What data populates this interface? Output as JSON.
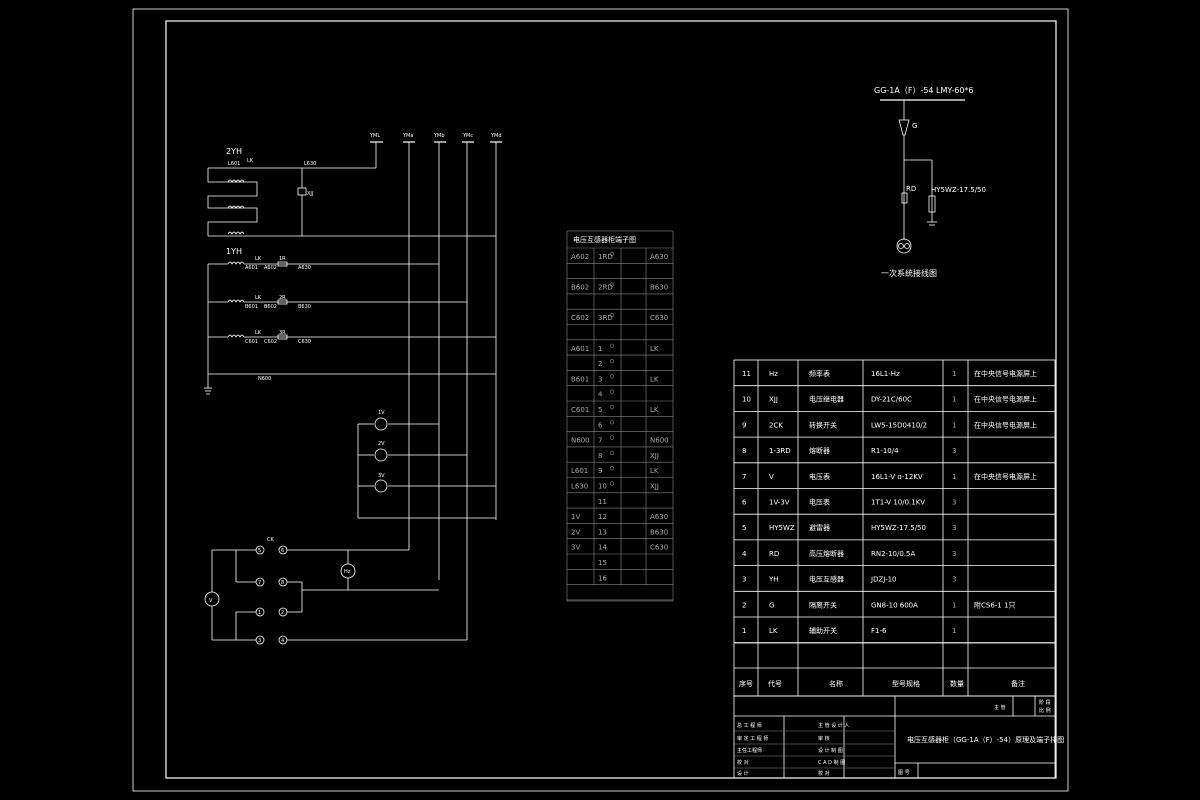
{
  "primary": {
    "header": "GG-1A（F）-54  LMY-60*6",
    "g_label": "G",
    "rd_label": "RD",
    "arrester_label": "HY5WZ-17.5/50",
    "caption": "一次系统接线图"
  },
  "schematic": {
    "bus_labels": [
      "YML",
      "YMa",
      "YMb",
      "YMc",
      "YMd"
    ],
    "vt2_label": "2YH",
    "vt1_label": "1YH",
    "xjj_label": "XJJ",
    "lk_label": "LK",
    "ck_label": "CK",
    "wire_labels": {
      "l601": "L601",
      "l630": "L630",
      "a601": "A601",
      "a602": "A602",
      "a630": "A630",
      "b601": "B601",
      "b602": "B602",
      "b630": "B630",
      "c601": "C601",
      "c602": "C602",
      "c630": "C630",
      "n600": "N600",
      "rd1": "1R",
      "rd2": "2R",
      "rd3": "3R"
    },
    "meters": [
      "1V",
      "2V",
      "3V"
    ],
    "freq_meter": "Hz",
    "voltmeter": "V",
    "switch_contacts": [
      "5",
      "6",
      "7",
      "8",
      "1",
      "2",
      "3",
      "4"
    ]
  },
  "terminal": {
    "title": "电压互感器柜端子图",
    "rows": [
      {
        "left": "A602",
        "mid": "1RD",
        "right": "A630"
      },
      {
        "left": "",
        "mid": "",
        "right": ""
      },
      {
        "left": "B602",
        "mid": "2RD",
        "right": "B630"
      },
      {
        "left": "",
        "mid": "",
        "right": ""
      },
      {
        "left": "C602",
        "mid": "3RD",
        "right": "C630"
      },
      {
        "left": "",
        "mid": "",
        "right": ""
      },
      {
        "left": "A601",
        "mid": "1",
        "right": "LK"
      },
      {
        "left": "",
        "mid": "2",
        "right": ""
      },
      {
        "left": "B601",
        "mid": "3",
        "right": "LK"
      },
      {
        "left": "",
        "mid": "4",
        "right": ""
      },
      {
        "left": "C601",
        "mid": "5",
        "right": "LK"
      },
      {
        "left": "",
        "mid": "6",
        "right": ""
      },
      {
        "left": "N600",
        "mid": "7",
        "right": "N600"
      },
      {
        "left": "",
        "mid": "8",
        "right": "XJJ"
      },
      {
        "left": "L601",
        "mid": "9",
        "right": "LK"
      },
      {
        "left": "L630",
        "mid": "10",
        "right": "XJJ"
      },
      {
        "left": "",
        "mid": "11",
        "right": ""
      },
      {
        "left": "1V",
        "mid": "12",
        "right": "A630"
      },
      {
        "left": "2V",
        "mid": "13",
        "right": "B630"
      },
      {
        "left": "3V",
        "mid": "14",
        "right": "C630"
      },
      {
        "left": "",
        "mid": "15",
        "right": ""
      },
      {
        "left": "",
        "mid": "16",
        "right": ""
      },
      {
        "left": "",
        "mid": "",
        "right": ""
      }
    ]
  },
  "bom": {
    "headers": {
      "no": "序号",
      "code": "代号",
      "name": "名称",
      "model": "型号规格",
      "qty": "数量",
      "note": "备注"
    },
    "rows": [
      {
        "no": "11",
        "code": "Hz",
        "name": "频率表",
        "model": "16L1-Hz",
        "qty": "1",
        "note": "在中央信号电源屏上"
      },
      {
        "no": "10",
        "code": "XJJ",
        "name": "电压继电器",
        "model": "DY-21C/60C",
        "qty": "1",
        "note": "在中央信号电源屏上"
      },
      {
        "no": "9",
        "code": "2CK",
        "name": "转换开关",
        "model": "LW5-15D0410/2",
        "qty": "1",
        "note": "在中央信号电源屏上"
      },
      {
        "no": "8",
        "code": "1-3RD",
        "name": "熔断器",
        "model": "R1-10/4",
        "qty": "3",
        "note": ""
      },
      {
        "no": "7",
        "code": "V",
        "name": "电压表",
        "model": "16L1-V ɑ-12KV",
        "qty": "1",
        "note": "在中央信号电源屏上"
      },
      {
        "no": "6",
        "code": "1V-3V",
        "name": "电压表",
        "model": "1T1-V 10/0.1KV",
        "qty": "3",
        "note": ""
      },
      {
        "no": "5",
        "code": "HY5WZ",
        "name": "避雷器",
        "model": "HY5WZ-17.5/50",
        "qty": "3",
        "note": ""
      },
      {
        "no": "4",
        "code": "RD",
        "name": "高压熔断器",
        "model": "RN2-10/0.5A",
        "qty": "3",
        "note": ""
      },
      {
        "no": "3",
        "code": "YH",
        "name": "电压互感器",
        "model": "JDZJ-10",
        "qty": "3",
        "note": ""
      },
      {
        "no": "2",
        "code": "G",
        "name": "隔离开关",
        "model": "GN8-10 600A",
        "qty": "1",
        "note": "附CS6-1 1只"
      },
      {
        "no": "1",
        "code": "LK",
        "name": "辅助开关",
        "model": "F1-6",
        "qty": "1",
        "note": ""
      }
    ]
  },
  "title_block": {
    "drawing_title": "电压互感器柜（GG-1A（F）-54）原理及端子排图",
    "left_labels": [
      "总 工 程 师",
      "审 定 工 程 师",
      "主任工程师",
      "校 对",
      "设 计"
    ],
    "mid_labels": [
      "主 管 设 计 人",
      "审 核",
      "设 计 制 图",
      "C A D 制 图",
      "校 对"
    ],
    "top_right": "主 管",
    "stage": "阶 段",
    "scale": "比 例",
    "drawing_no": "图 号"
  }
}
